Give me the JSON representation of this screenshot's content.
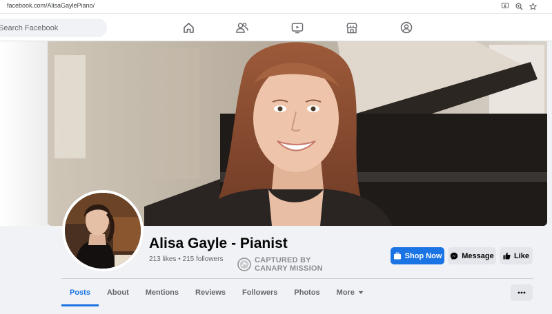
{
  "browser": {
    "url": "facebook.com/AlisaGaylePiano/"
  },
  "nav": {
    "search_placeholder": "Search Facebook",
    "icons": [
      "home-icon",
      "friends-icon",
      "watch-icon",
      "marketplace-icon",
      "groups-icon"
    ]
  },
  "page": {
    "name": "Alisa Gayle - Pianist",
    "stats": "213 likes • 215 followers"
  },
  "stamp": {
    "line1": "CAPTURED BY",
    "line2": "CANARY MISSION"
  },
  "actions": {
    "shop_label": "Shop Now",
    "message_label": "Message",
    "like_label": "Like"
  },
  "tabs": [
    {
      "label": "Posts",
      "active": true
    },
    {
      "label": "About"
    },
    {
      "label": "Mentions"
    },
    {
      "label": "Reviews"
    },
    {
      "label": "Followers"
    },
    {
      "label": "Photos"
    },
    {
      "label": "More"
    }
  ],
  "colors": {
    "brand_blue": "#1b74e4",
    "button_gray": "#e4e6eb",
    "text_secondary": "#65676b"
  }
}
